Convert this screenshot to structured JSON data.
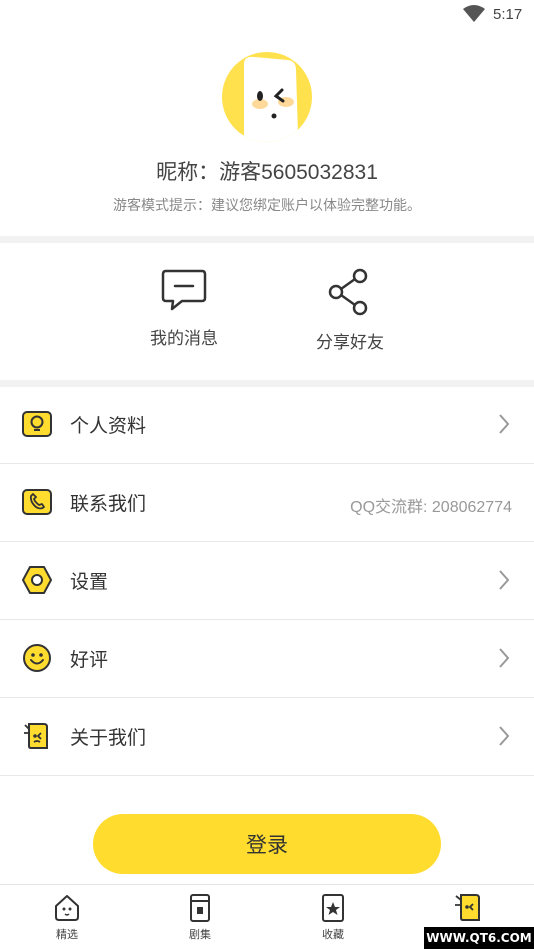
{
  "status_bar": {
    "time": "5:17"
  },
  "profile": {
    "nickname": "昵称：游客5605032831",
    "hint": "游客模式提示：建议您绑定账户以体验完整功能。"
  },
  "quick_actions": [
    {
      "label": "我的消息",
      "icon": "message-icon"
    },
    {
      "label": "分享好友",
      "icon": "share-icon"
    }
  ],
  "menu": [
    {
      "label": "个人资料",
      "icon": "bulb-icon",
      "extra": ""
    },
    {
      "label": "联系我们",
      "icon": "phone-icon",
      "extra": "QQ交流群: 208062774"
    },
    {
      "label": "设置",
      "icon": "hex-nut-icon",
      "extra": ""
    },
    {
      "label": "好评",
      "icon": "smiley-icon",
      "extra": ""
    },
    {
      "label": "关于我们",
      "icon": "mascot-icon",
      "extra": ""
    }
  ],
  "login_label": "登录",
  "tabs": [
    {
      "label": "精选",
      "icon": "house-mascot-icon"
    },
    {
      "label": "剧集",
      "icon": "book-icon"
    },
    {
      "label": "收藏",
      "icon": "star-card-icon"
    },
    {
      "label": "",
      "icon": "mascot-icon",
      "active": true
    }
  ],
  "watermark": "WWW.QT6.COM",
  "colors": {
    "accent": "#ffdc2e",
    "separator": "#f2f2f2",
    "text": "#333333",
    "muted": "#999999"
  }
}
